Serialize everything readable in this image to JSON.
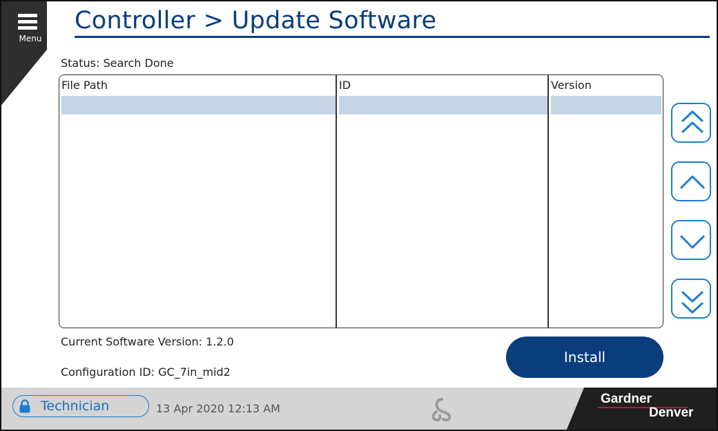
{
  "header": {
    "menu_label": "Menu",
    "title": "Controller > Update Software"
  },
  "status": "Status: Search Done",
  "table": {
    "columns": [
      "File Path",
      "ID",
      "Version"
    ],
    "rows": [
      [
        "",
        "",
        ""
      ]
    ],
    "selected_row": 0
  },
  "scroll_buttons": [
    {
      "name": "page-up",
      "icon": "double-chevron-up-icon"
    },
    {
      "name": "line-up",
      "icon": "chevron-up-icon"
    },
    {
      "name": "line-down",
      "icon": "chevron-down-icon"
    },
    {
      "name": "page-down",
      "icon": "double-chevron-down-icon"
    }
  ],
  "info": {
    "current_version": "Current Software Version: 1.2.0",
    "config_id": "Configuration ID: GC_7in_mid2"
  },
  "install_label": "Install",
  "footer": {
    "user_level": "Technician",
    "datetime": "13 Apr 2020  12:13 AM",
    "brand_top": "Gardner",
    "brand_bottom": "Denver"
  },
  "colors": {
    "title_blue": "#0a3d7c",
    "accent_blue": "#1b7dd3",
    "selection_row": "#c6d5e5",
    "footer_gray": "#d4d4d4",
    "brand_red": "#c8102e"
  }
}
